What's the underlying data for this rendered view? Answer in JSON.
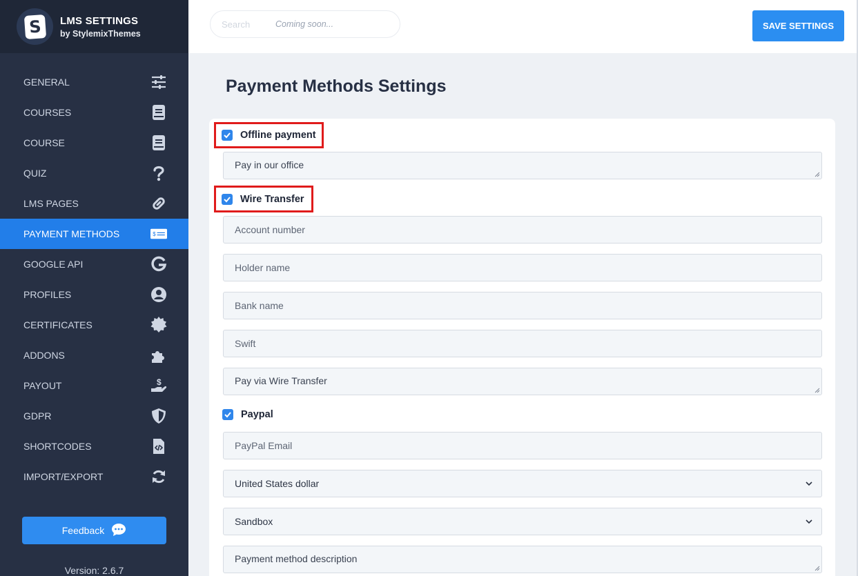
{
  "brand": {
    "title": "LMS SETTINGS",
    "subtitle": "by StylemixThemes",
    "logo_letter": "S"
  },
  "nav": [
    {
      "label": "GENERAL",
      "icon": "sliders-icon"
    },
    {
      "label": "COURSES",
      "icon": "book-icon"
    },
    {
      "label": "COURSE",
      "icon": "book-icon"
    },
    {
      "label": "QUIZ",
      "icon": "question-icon"
    },
    {
      "label": "LMS PAGES",
      "icon": "link-icon"
    },
    {
      "label": "PAYMENT METHODS",
      "icon": "money-bill-icon",
      "active": true
    },
    {
      "label": "GOOGLE API",
      "icon": "google-icon"
    },
    {
      "label": "PROFILES",
      "icon": "user-circle-icon"
    },
    {
      "label": "CERTIFICATES",
      "icon": "certificate-icon"
    },
    {
      "label": "ADDONS",
      "icon": "puzzle-icon"
    },
    {
      "label": "PAYOUT",
      "icon": "hand-dollar-icon"
    },
    {
      "label": "GDPR",
      "icon": "shield-icon"
    },
    {
      "label": "SHORTCODES",
      "icon": "file-code-icon"
    },
    {
      "label": "IMPORT/EXPORT",
      "icon": "sync-icon"
    }
  ],
  "feedback_label": "Feedback",
  "version": "Version: 2.6.7",
  "topbar": {
    "search_placeholder": "Search",
    "search_note": "Coming soon...",
    "save_label": "SAVE SETTINGS"
  },
  "page_title": "Payment Methods Settings",
  "methods": {
    "offline": {
      "label": "Offline payment",
      "checked": true,
      "description": "Pay in our office"
    },
    "wire": {
      "label": "Wire Transfer",
      "checked": true,
      "account_number": "Account number",
      "holder_name": "Holder name",
      "bank_name": "Bank name",
      "swift": "Swift",
      "description": "Pay via Wire Transfer"
    },
    "paypal": {
      "label": "Paypal",
      "checked": true,
      "email": "PayPal Email",
      "currency": "United States dollar",
      "mode": "Sandbox",
      "description": "Payment method description"
    }
  },
  "colors": {
    "sidebar": "#273044",
    "active": "#227ee9",
    "accent": "#2b8ef1",
    "highlight": "#e01b1b"
  }
}
